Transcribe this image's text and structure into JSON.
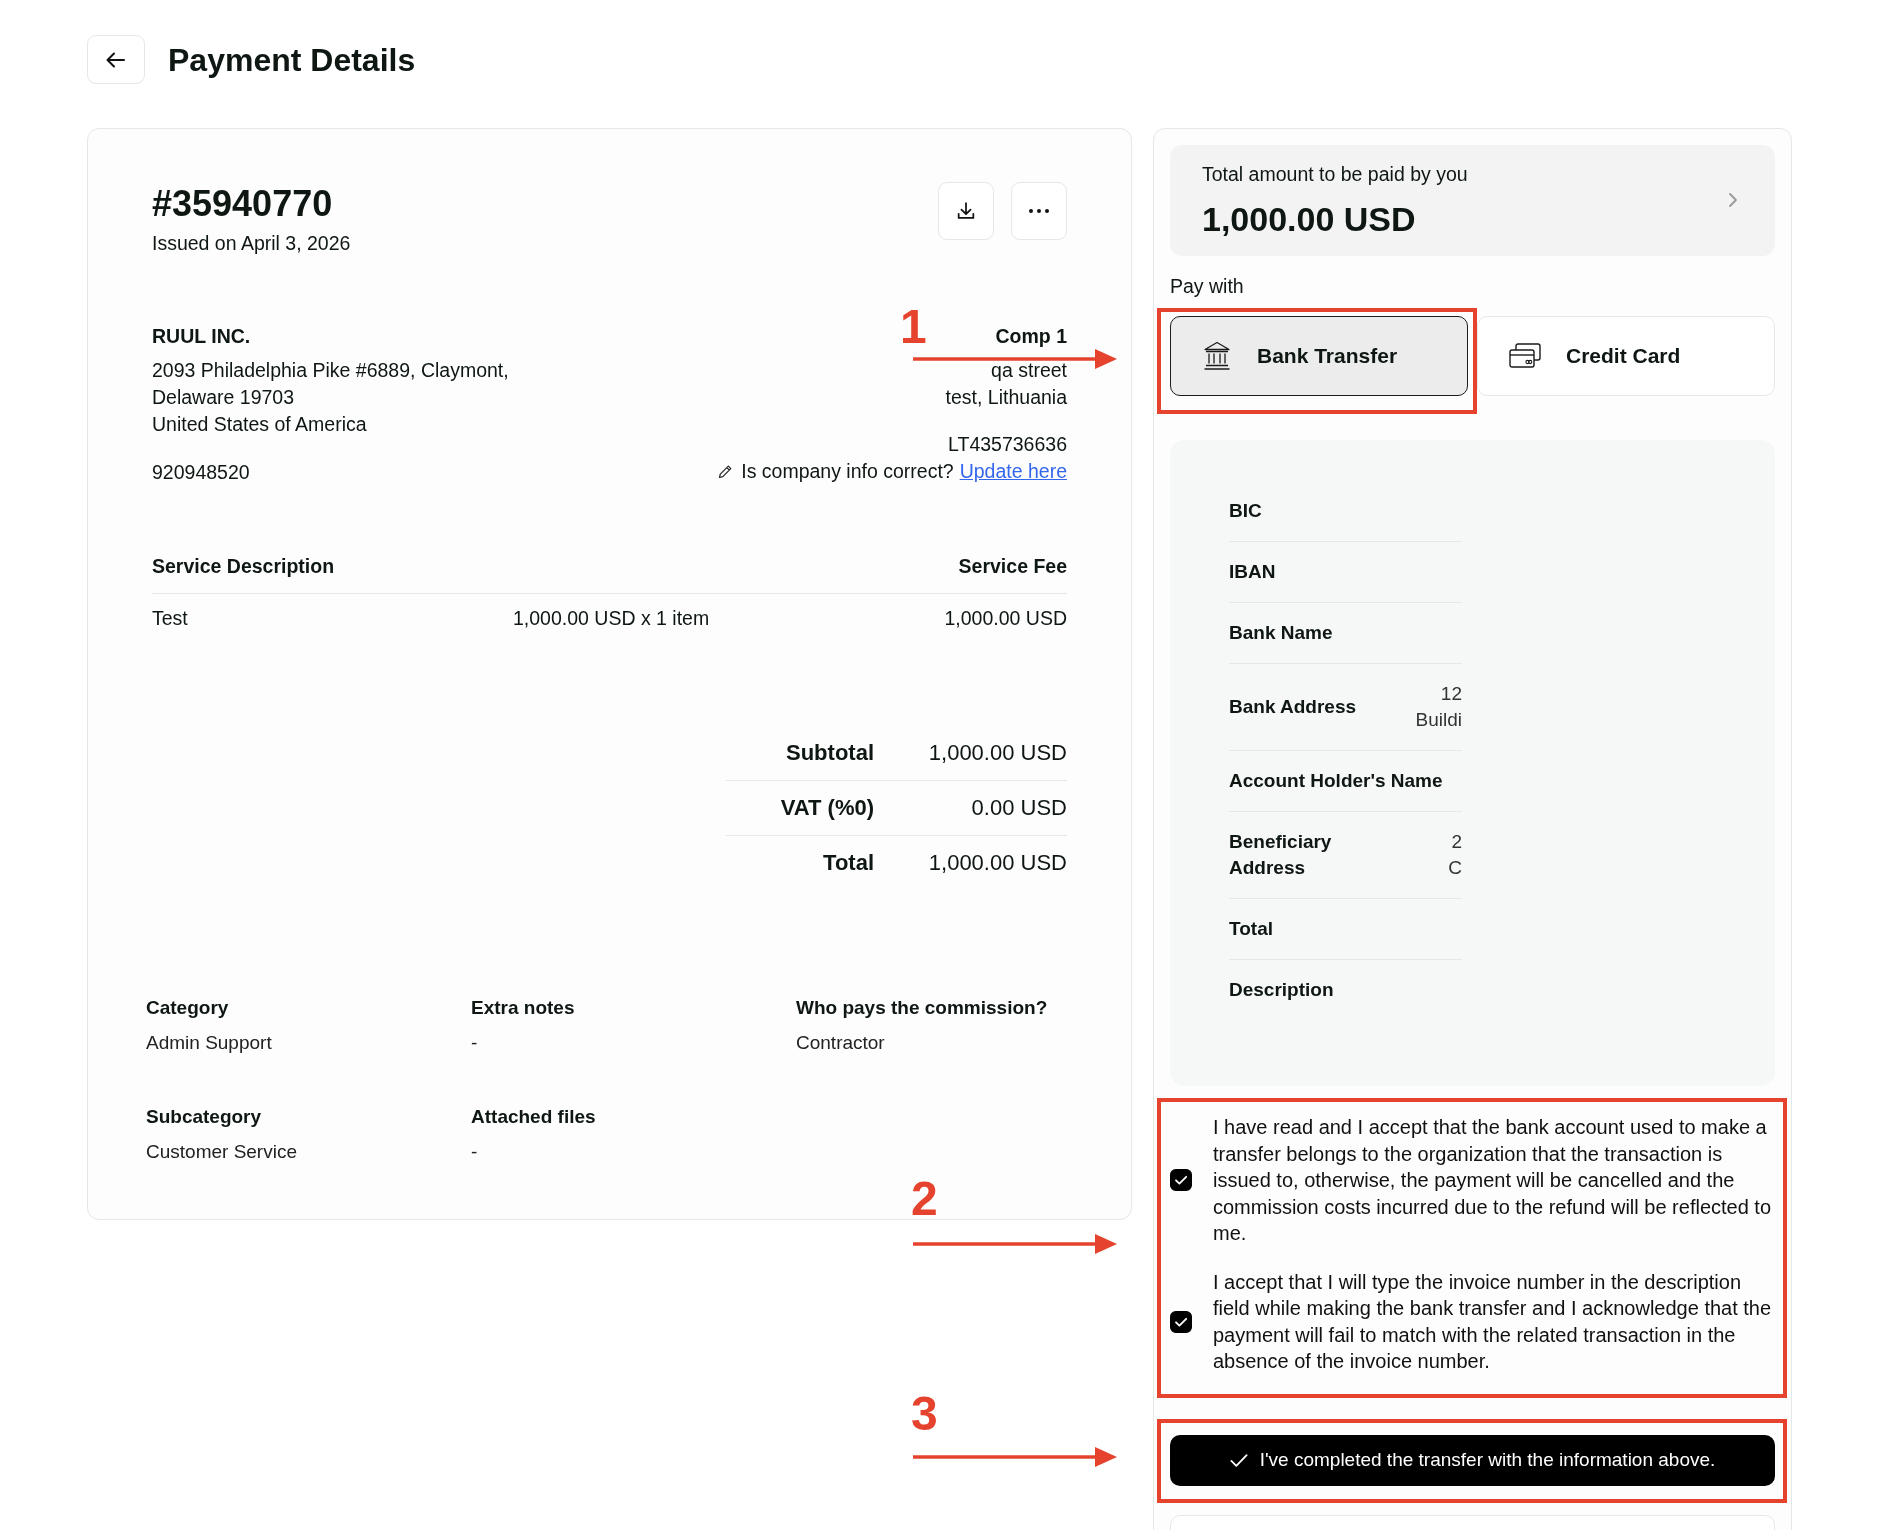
{
  "header": {
    "title": "Payment Details"
  },
  "invoice": {
    "number": "#35940770",
    "issued": "Issued on April 3, 2026",
    "sender": {
      "name": "RUUL INC.",
      "address_lines": [
        "2093 Philadelphia Pike #6889, Claymont,",
        "Delaware 19703",
        "United States of America"
      ],
      "tax_id": "920948520"
    },
    "recipient": {
      "name": "Comp 1",
      "address_lines": [
        "qa street",
        "test, Lithuania"
      ],
      "tax_id": "LT435736636",
      "prompt": "Is company info correct?",
      "link": "Update here"
    },
    "services": {
      "columns": [
        "Service Description",
        "Service Fee"
      ],
      "rows": [
        {
          "description": "Test",
          "quantity": "1,000.00 USD x 1 item",
          "fee": "1,000.00 USD"
        }
      ]
    },
    "totals": [
      {
        "label": "Subtotal",
        "value": "1,000.00 USD"
      },
      {
        "label": "VAT (%0)",
        "value": "0.00 USD"
      },
      {
        "label": "Total",
        "value": "1,000.00 USD"
      }
    ],
    "details": [
      {
        "label": "Category",
        "value": "Admin Support"
      },
      {
        "label": "Extra notes",
        "value": "-"
      },
      {
        "label": "Who pays the commission?",
        "value": "Contractor"
      },
      {
        "label": "Subcategory",
        "value": "Customer Service"
      },
      {
        "label": "Attached files",
        "value": "-"
      }
    ]
  },
  "payment": {
    "total_label": "Total amount to be paid by you",
    "total_amount": "1,000.00 USD",
    "pay_with": "Pay with",
    "methods": [
      {
        "label": "Bank Transfer",
        "kind": "bank",
        "selected": true
      },
      {
        "label": "Credit Card",
        "kind": "card",
        "selected": false
      }
    ],
    "bank_details": [
      {
        "label": "BIC"
      },
      {
        "label": "IBAN"
      },
      {
        "label": "Bank Name"
      },
      {
        "label": "Bank Address",
        "value_lines": [
          "12",
          "Buildi"
        ]
      },
      {
        "label": "Account Holder's Name"
      },
      {
        "label": "Beneficiary Address",
        "value_lines": [
          "2",
          "C"
        ]
      },
      {
        "label": "Total"
      },
      {
        "label": "Description"
      }
    ],
    "consents": [
      {
        "text": "I have read and I accept that the bank account used to make a transfer belongs to the organization that the transaction is issued to, otherwise, the payment will be cancelled and the commission costs incurred due to the refund will be reflected to me.",
        "checked": true
      },
      {
        "text": "I accept that I will type the invoice number in the description field while making the bank transfer and I acknowledge that the payment will fail to match with the related transaction in the absence of the invoice number.",
        "checked": true
      }
    ],
    "confirm_button": "I've completed the transfer with the information above."
  },
  "annotations": [
    {
      "label": "1"
    },
    {
      "label": "2"
    },
    {
      "label": "3"
    }
  ]
}
